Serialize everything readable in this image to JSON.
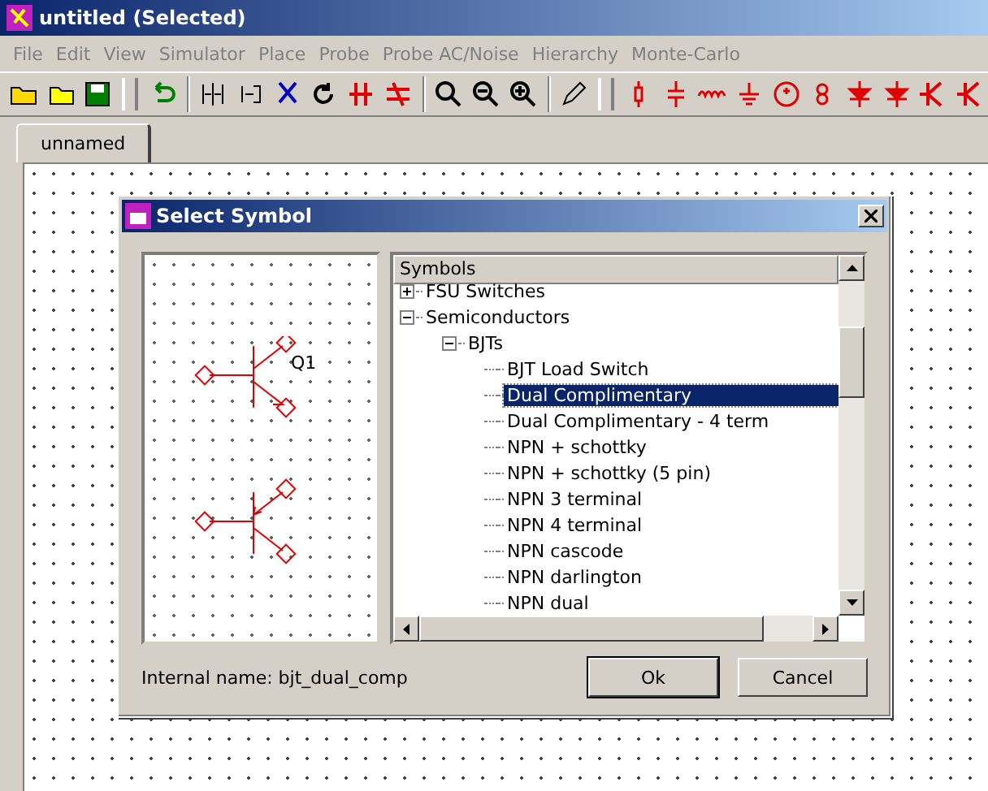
{
  "window": {
    "title": "untitled (Selected)"
  },
  "menu": [
    {
      "label": "File",
      "disabled": true
    },
    {
      "label": "Edit",
      "disabled": true
    },
    {
      "label": "View",
      "disabled": true
    },
    {
      "label": "Simulator",
      "disabled": true
    },
    {
      "label": "Place",
      "disabled": true
    },
    {
      "label": "Probe",
      "disabled": true
    },
    {
      "label": "Probe AC/Noise",
      "disabled": true
    },
    {
      "label": "Hierarchy",
      "disabled": true
    },
    {
      "label": "Monte-Carlo",
      "disabled": true
    }
  ],
  "tabs": [
    {
      "label": "unnamed",
      "selected": true
    }
  ],
  "dialog": {
    "title": "Select Symbol",
    "preview": {
      "label": "Q1"
    },
    "tree": {
      "header": "Symbols",
      "items": [
        {
          "label": "FSU Switches",
          "expanded": false,
          "selected": false
        },
        {
          "label": "Semiconductors",
          "expanded": true,
          "selected": false,
          "children": [
            {
              "label": "BJTs",
              "expanded": true,
              "selected": false,
              "children": [
                {
                  "label": "BJT Load Switch",
                  "selected": false
                },
                {
                  "label": "Dual Complimentary",
                  "selected": true
                },
                {
                  "label": "Dual Complimentary - 4 term",
                  "selected": false
                },
                {
                  "label": "NPN + schottky",
                  "selected": false
                },
                {
                  "label": "NPN + schottky (5 pin)",
                  "selected": false
                },
                {
                  "label": "NPN 3 terminal",
                  "selected": false
                },
                {
                  "label": "NPN 4 terminal",
                  "selected": false
                },
                {
                  "label": "NPN cascode",
                  "selected": false
                },
                {
                  "label": "NPN darlington",
                  "selected": false
                },
                {
                  "label": "NPN dual",
                  "selected": false
                }
              ]
            }
          ]
        }
      ]
    },
    "internal_name": "Internal name: bjt_dual_comp",
    "buttons": [
      "Ok",
      "Cancel"
    ]
  }
}
